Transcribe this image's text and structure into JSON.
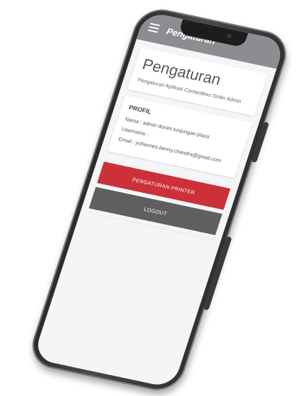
{
  "app_bar": {
    "title": "Pengaturan"
  },
  "header": {
    "title": "Pengaturan",
    "subtitle": "Pengaturan Aplikasi Contactless Order Admin"
  },
  "profile": {
    "heading": "PROFIL",
    "name": "Nama : admin donini tunjungan plaza",
    "username": "Username :",
    "email": "Email : yohannes.benny.chandra@gmail.com"
  },
  "buttons": {
    "printer": "PENGATURAN PRINTER",
    "logout": "LOGOUT"
  },
  "colors": {
    "app_bar": "#8b8d91",
    "printer_button": "#cc3038",
    "logout_button": "#5f5f5f",
    "screen_background": "#f4f5f7"
  }
}
